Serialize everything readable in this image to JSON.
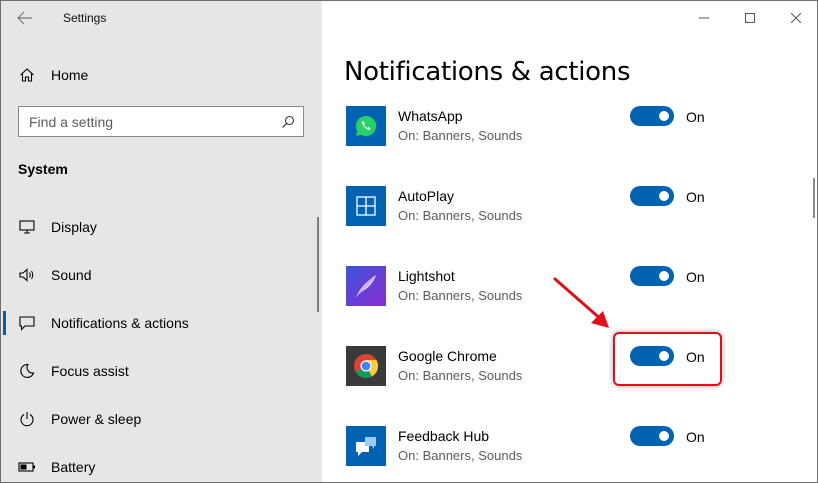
{
  "window": {
    "title": "Settings"
  },
  "sidebar": {
    "home_label": "Home",
    "search_placeholder": "Find a setting",
    "section_title": "System",
    "items": [
      {
        "label": "Display",
        "icon": "monitor-icon"
      },
      {
        "label": "Sound",
        "icon": "speaker-icon"
      },
      {
        "label": "Notifications & actions",
        "icon": "notification-icon",
        "selected": true
      },
      {
        "label": "Focus assist",
        "icon": "moon-icon"
      },
      {
        "label": "Power & sleep",
        "icon": "power-icon"
      },
      {
        "label": "Battery",
        "icon": "battery-icon"
      }
    ]
  },
  "main": {
    "title": "Notifications & actions",
    "apps": [
      {
        "name": "WhatsApp",
        "status": "On: Banners, Sounds",
        "toggle": "On",
        "icon_color": "#0063b1"
      },
      {
        "name": "AutoPlay",
        "status": "On: Banners, Sounds",
        "toggle": "On",
        "icon_color": "#0063b1"
      },
      {
        "name": "Lightshot",
        "status": "On: Banners, Sounds",
        "toggle": "On",
        "icon_color": "#5a3fc0"
      },
      {
        "name": "Google Chrome",
        "status": "On: Banners, Sounds",
        "toggle": "On",
        "icon_color": "#3a3a3a"
      },
      {
        "name": "Feedback Hub",
        "status": "On: Banners, Sounds",
        "toggle": "On",
        "icon_color": "#0063b1"
      }
    ]
  },
  "colors": {
    "accent": "#0063b1",
    "annotation": "#e0101a",
    "sidebar_bg": "#e6e6e6"
  }
}
